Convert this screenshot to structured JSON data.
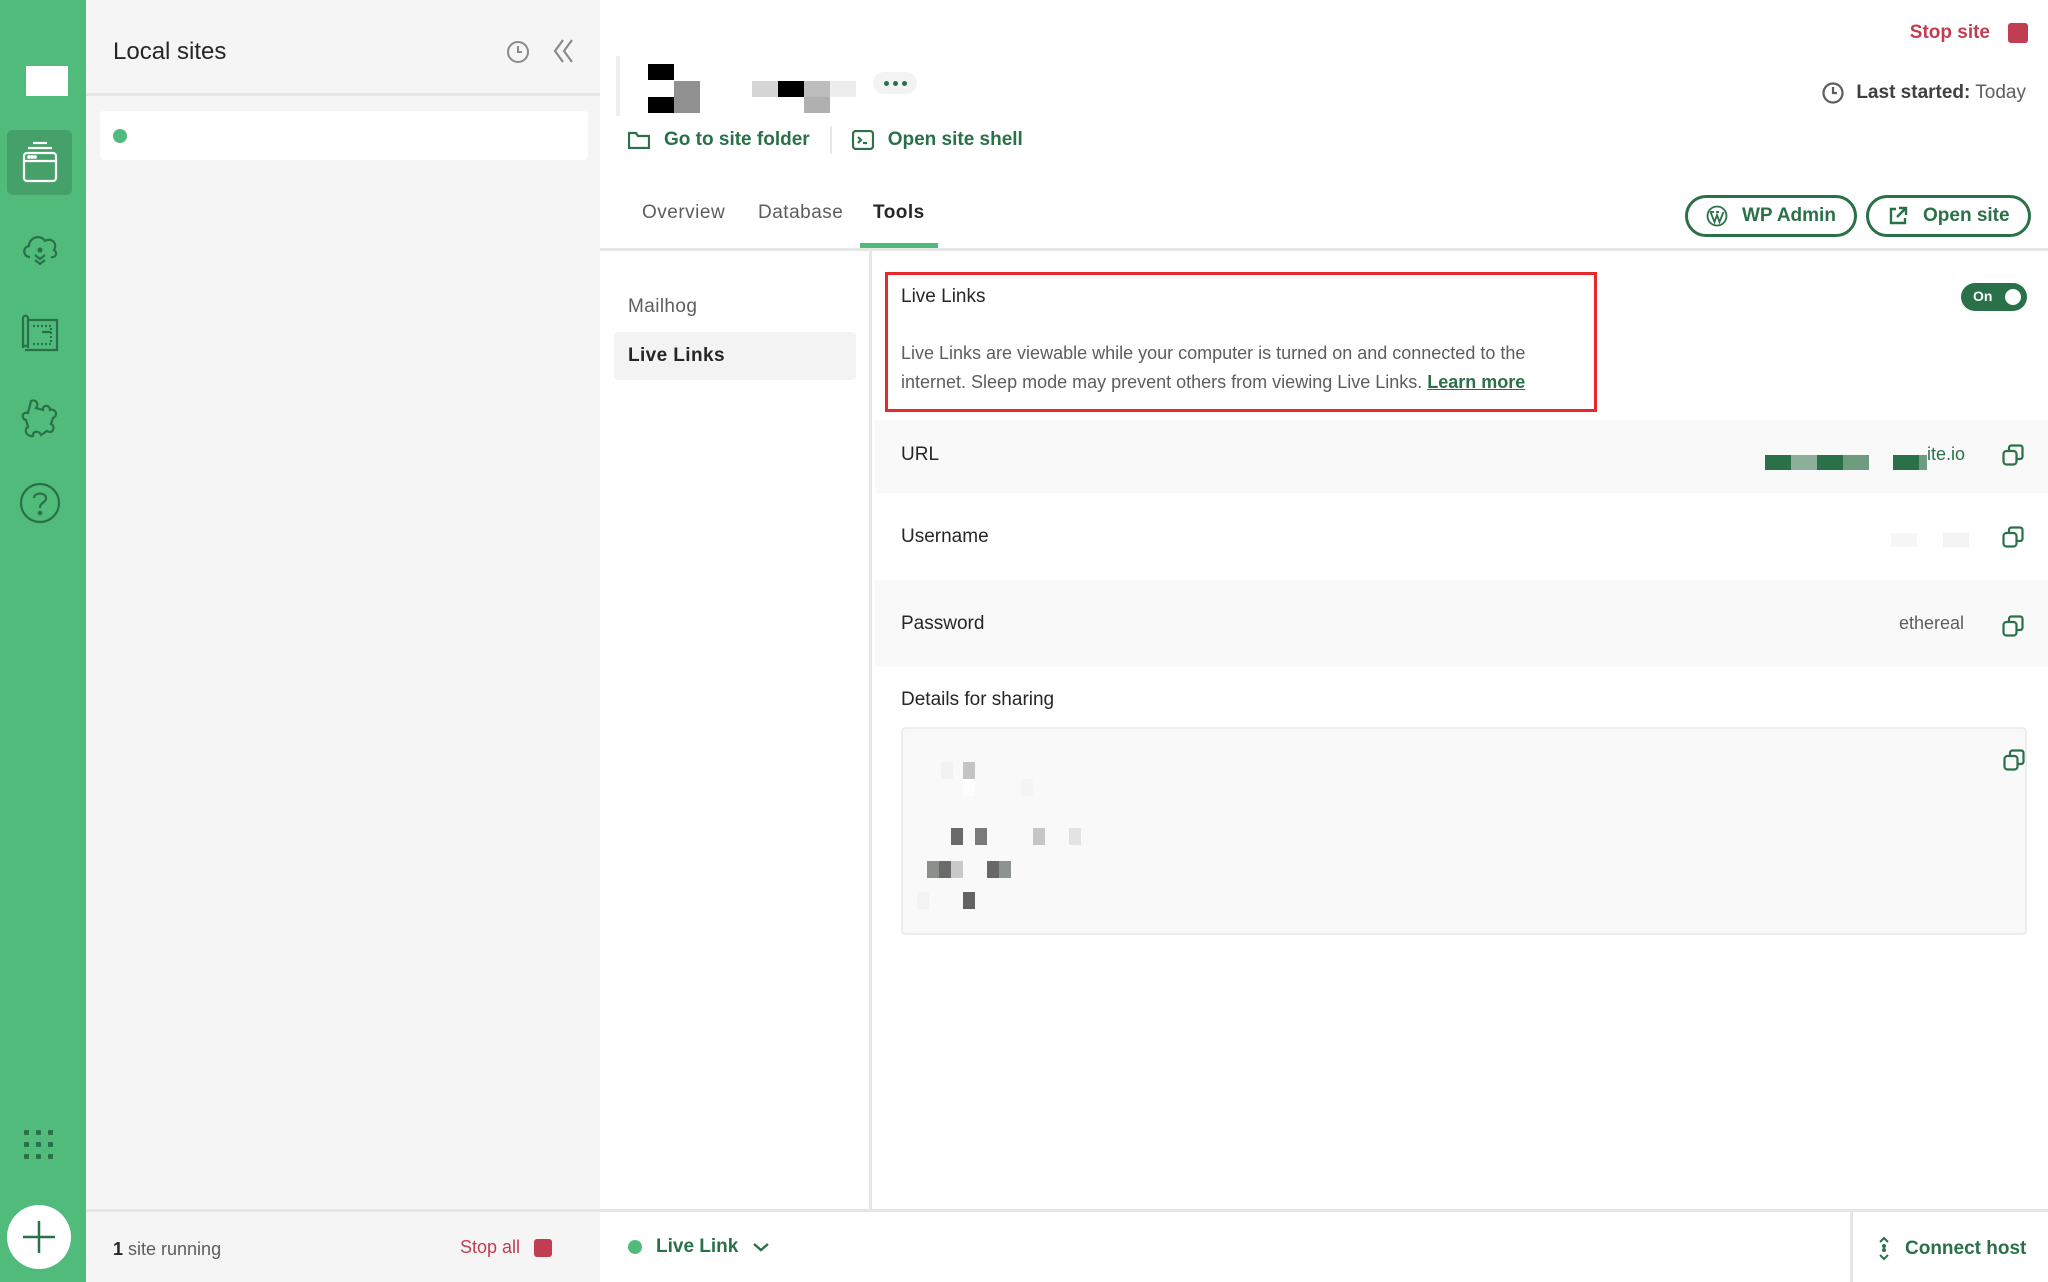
{
  "nav": {
    "items": [
      {
        "name": "local-sites",
        "icon": "local-sites-icon",
        "active": true
      },
      {
        "name": "connect-cloud",
        "icon": "cloud-download-icon"
      },
      {
        "name": "blueprints",
        "icon": "blueprint-icon"
      },
      {
        "name": "add-ons",
        "icon": "puzzle-icon"
      },
      {
        "name": "help",
        "icon": "help-icon"
      }
    ],
    "grid_icon": "grid-icon",
    "add_icon": "plus-icon"
  },
  "sites_panel": {
    "title": "Local sites",
    "history_icon": "clock-icon",
    "collapse_icon": "double-chevron-left-icon",
    "sites": [
      {
        "name": "",
        "status": "running"
      }
    ],
    "footer": {
      "running_count": "1",
      "running_text": " site running",
      "stop_all_label": "Stop all"
    }
  },
  "header": {
    "more_icon": "ellipsis-icon",
    "go_to_folder": "Go to site folder",
    "open_shell": "Open site shell",
    "stop_site": "Stop site",
    "last_started_label": "Last started:",
    "last_started_value": " Today"
  },
  "tabs": [
    {
      "label": "Overview"
    },
    {
      "label": "Database"
    },
    {
      "label": "Tools",
      "active": true
    }
  ],
  "header_buttons": {
    "wp_admin": "WP Admin",
    "open_site": "Open site"
  },
  "tools_nav": [
    {
      "label": "Mailhog"
    },
    {
      "label": "Live Links",
      "active": true
    }
  ],
  "live_links": {
    "title": "Live Links",
    "description": "Live Links are viewable while your computer is turned on and connected to the internet. Sleep mode may prevent others from viewing Live Links. ",
    "learn_more": "Learn more",
    "toggle_label": "On",
    "toggle_on": true,
    "rows": {
      "url": {
        "label": "URL",
        "value_suffix": "ite.io"
      },
      "username": {
        "label": "Username",
        "value": ""
      },
      "password": {
        "label": "Password",
        "value": "ethereal"
      },
      "details": {
        "label": "Details for sharing"
      }
    }
  },
  "footer": {
    "live_link": "Live Link",
    "connect_host": "Connect host"
  },
  "colors": {
    "brand_green": "#51BB7B",
    "dark_green": "#2A7048",
    "stop_red": "#C13D52",
    "highlight_red": "#E8282B"
  }
}
